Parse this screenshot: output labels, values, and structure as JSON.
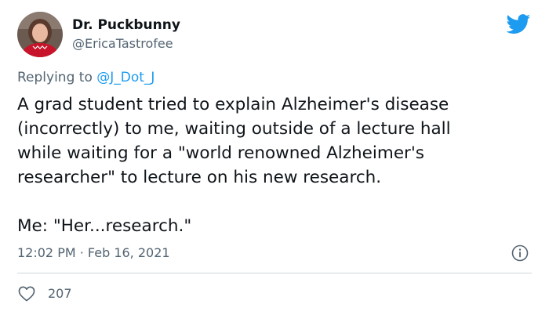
{
  "author": {
    "display_name": "Dr. Puckbunny",
    "handle": "@EricaTastrofee"
  },
  "reply": {
    "prefix": "Replying to ",
    "mention": "@J_Dot_J"
  },
  "tweet": {
    "lines": [
      "A grad student tried to explain Alzheimer's disease",
      "(incorrectly) to me, waiting outside of a lecture hall",
      "while waiting for a \"world renowned Alzheimer's",
      "researcher\" to lecture on his new research."
    ],
    "closing_line": "Me: \"Her...research.\"",
    "timestamp": "12:02 PM · Feb 16, 2021"
  },
  "stats": {
    "likes": "207"
  },
  "icons": {
    "brand": "twitter-bird-icon",
    "info": "info-icon",
    "like": "heart-icon"
  },
  "colors": {
    "brand": "#1d9bf0",
    "text": "#0f1419",
    "muted": "#536471",
    "divider": "#cfd9de"
  }
}
